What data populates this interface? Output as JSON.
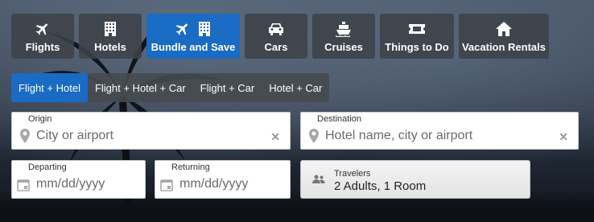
{
  "product_tabs": [
    {
      "label": "Flights",
      "icon": "plane-icon"
    },
    {
      "label": "Hotels",
      "icon": "building-icon"
    },
    {
      "label": "Bundle and Save",
      "icon": "plane-building-icon",
      "active": true
    },
    {
      "label": "Cars",
      "icon": "car-icon"
    },
    {
      "label": "Cruises",
      "icon": "ship-icon"
    },
    {
      "label": "Things to Do",
      "icon": "ticket-icon"
    },
    {
      "label": "Vacation Rentals",
      "icon": "house-icon"
    }
  ],
  "bundle_tabs": [
    {
      "label": "Flight + Hotel",
      "active": true
    },
    {
      "label": "Flight + Hotel + Car"
    },
    {
      "label": "Flight + Car"
    },
    {
      "label": "Hotel + Car"
    }
  ],
  "form": {
    "origin": {
      "label": "Origin",
      "placeholder": "City or airport",
      "value": ""
    },
    "destination": {
      "label": "Destination",
      "placeholder": "Hotel name, city or airport",
      "value": ""
    },
    "departing": {
      "label": "Departing",
      "placeholder": "mm/dd/yyyy",
      "value": ""
    },
    "returning": {
      "label": "Returning",
      "placeholder": "mm/dd/yyyy",
      "value": ""
    },
    "travelers": {
      "label": "Travelers",
      "value": "2 Adults, 1 Room"
    },
    "clear_glyph": "✕"
  },
  "colors": {
    "accent": "#1a6bc4",
    "tab_bg": "#3e4248"
  }
}
